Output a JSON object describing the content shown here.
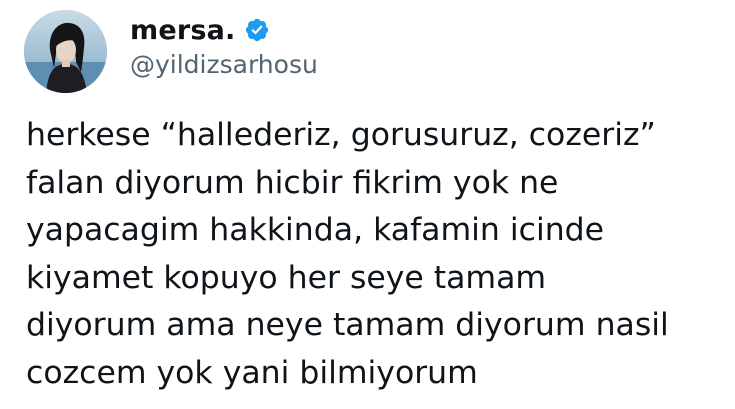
{
  "user": {
    "display_name": "mersa.",
    "handle": "@yildizsarhosu",
    "verified": true,
    "verified_color": "#1d9bf0"
  },
  "tweet": {
    "lines": [
      "herkese “hallederiz, gorusuruz, cozeriz”",
      "falan diyorum hicbir fikrim yok ne",
      "yapacagim hakkinda, kafamin icinde",
      "kiyamet kopuyo her seye tamam",
      "diyorum ama neye tamam diyorum nasil",
      "cozcem yok yani bilmiyorum"
    ]
  },
  "icons": {
    "avatar": "profile-photo",
    "badge": "verified-badge-icon"
  },
  "colors": {
    "text": "#0f1419",
    "secondary_text": "#536471",
    "background": "#ffffff"
  }
}
